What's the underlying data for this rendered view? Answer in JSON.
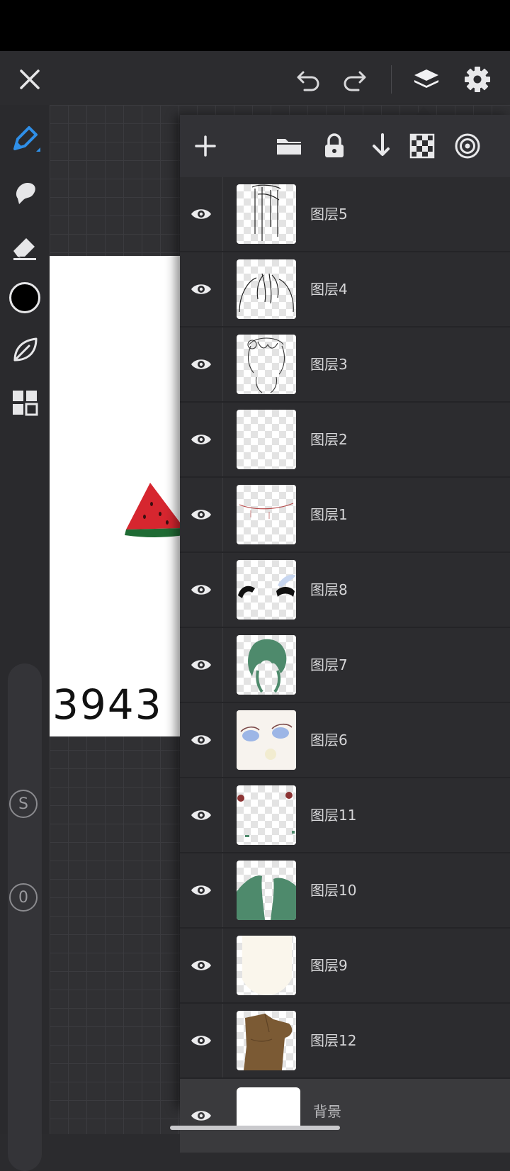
{
  "topbar": {
    "close_icon": "close-icon",
    "undo_icon": "undo-icon",
    "redo_icon": "redo-icon",
    "layers_icon": "layers-icon",
    "settings_icon": "gear-icon"
  },
  "tools": {
    "items": [
      "pen-icon",
      "smudge-icon",
      "eraser-icon",
      "color-swatch",
      "leaf-icon",
      "grid-icon"
    ],
    "active": "pen-icon",
    "current_color": "#000000",
    "accent": "#2f8fe8"
  },
  "sliders": {
    "size_label": "S",
    "opacity_label": "0"
  },
  "canvas": {
    "numbers_text": "3943"
  },
  "layers_panel": {
    "toolbar_icons": [
      "add-icon",
      "folder-icon",
      "lock-icon",
      "merge-down-icon",
      "alpha-lock-icon",
      "blend-mode-icon"
    ],
    "layers": [
      {
        "name": "图层5"
      },
      {
        "name": "图层4"
      },
      {
        "name": "图层3"
      },
      {
        "name": "图层2"
      },
      {
        "name": "图层1"
      },
      {
        "name": "图层8"
      },
      {
        "name": "图层7"
      },
      {
        "name": "图层6"
      },
      {
        "name": "图层11"
      },
      {
        "name": "图层10"
      },
      {
        "name": "图层9"
      },
      {
        "name": "图层12"
      }
    ],
    "background_label": "背景"
  }
}
